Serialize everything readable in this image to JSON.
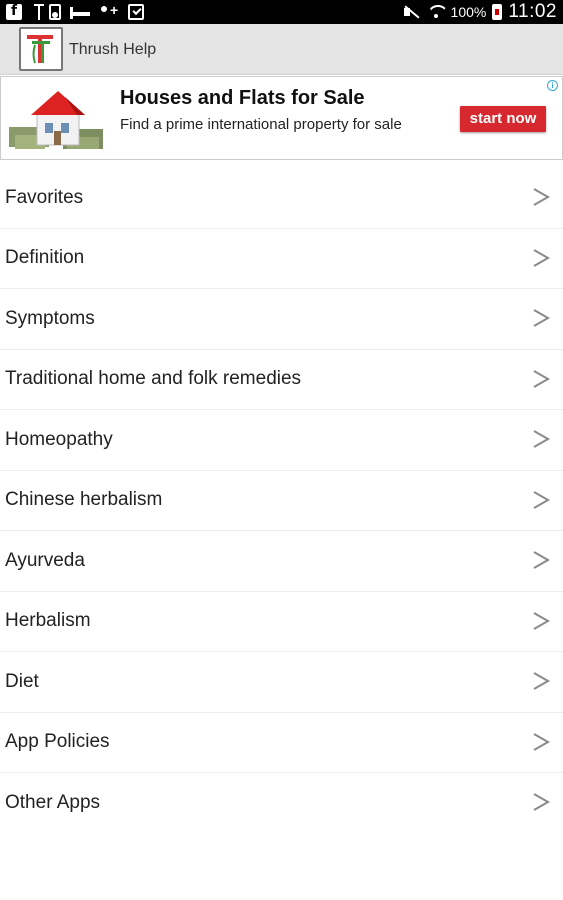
{
  "status_bar": {
    "battery_percent": "100%",
    "time": "11:02"
  },
  "app_bar": {
    "title": "Thrush Help"
  },
  "ad": {
    "headline": "Houses and Flats for Sale",
    "description": "Find a prime international property for sale",
    "cta": "start now",
    "info_icon": "i",
    "cta_color": "#d8282f"
  },
  "menu": {
    "items": [
      {
        "label": "Favorites"
      },
      {
        "label": "Definition"
      },
      {
        "label": "Symptoms"
      },
      {
        "label": "Traditional home and folk remedies"
      },
      {
        "label": "Homeopathy"
      },
      {
        "label": "Chinese herbalism"
      },
      {
        "label": "Ayurveda"
      },
      {
        "label": "Herbalism"
      },
      {
        "label": "Diet"
      },
      {
        "label": "App Policies"
      },
      {
        "label": "Other Apps"
      }
    ]
  }
}
